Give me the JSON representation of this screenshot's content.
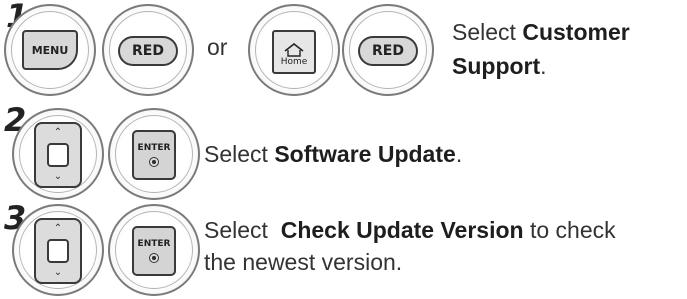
{
  "steps": [
    {
      "number": "1",
      "buttons": {
        "menu": "MENU",
        "red1": "RED",
        "home": "Home",
        "red2": "RED"
      },
      "or_text": "or",
      "line1_pre": "Select ",
      "line1_bold": "Customer",
      "line2_bold": "Support",
      "line2_post": "."
    },
    {
      "number": "2",
      "buttons": {
        "enter": "ENTER"
      },
      "pre": "Select ",
      "bold": "Software Update",
      "post": "."
    },
    {
      "number": "3",
      "buttons": {
        "enter": "ENTER"
      },
      "line1_pre": "Select  ",
      "line1_bold": "Check Update Version",
      "line1_post": " to check",
      "line2": "the newest version."
    }
  ]
}
